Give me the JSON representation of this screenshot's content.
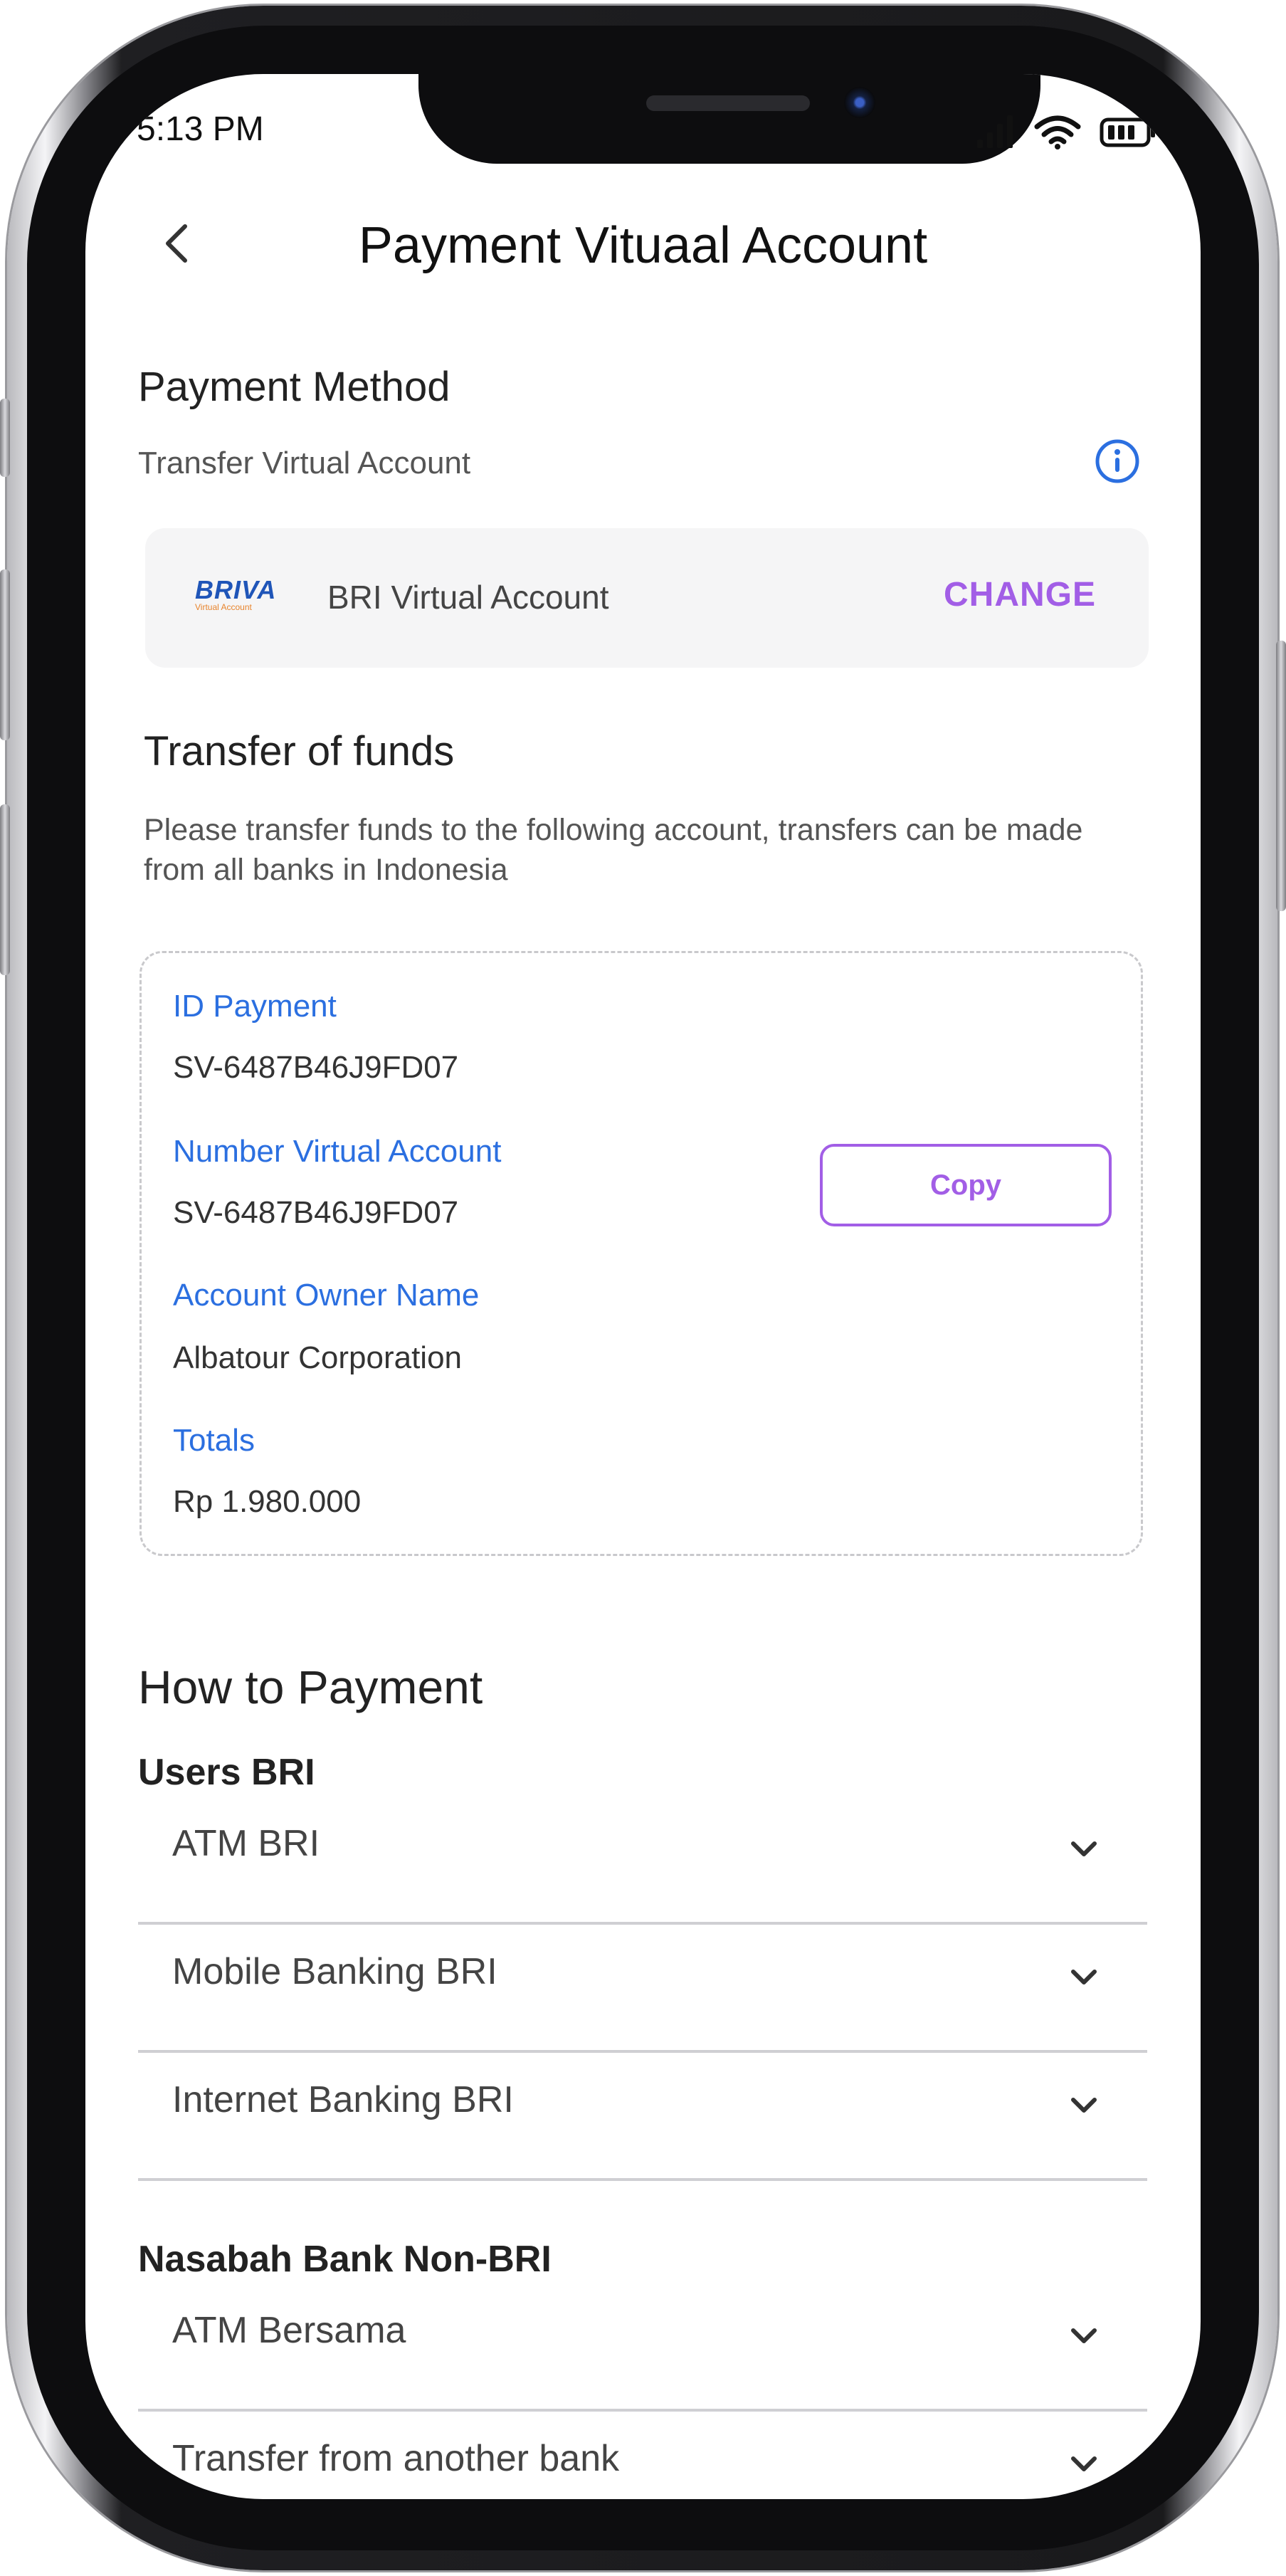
{
  "status_bar": {
    "time": "5:13 PM"
  },
  "header": {
    "title": "Payment Vituaal Account"
  },
  "payment_method": {
    "heading": "Payment Method",
    "subtitle": "Transfer Virtual Account",
    "logo_text": "BRIVA",
    "logo_subtext": "Virtual Account",
    "bank_name": "BRI Virtual Account",
    "change_label": "CHANGE"
  },
  "transfer": {
    "heading": "Transfer of funds",
    "description": "Please transfer funds to the following account, transfers can be made from all banks in Indonesia",
    "id_payment_label": "ID Payment",
    "id_payment_value": "SV-6487B46J9FD07",
    "va_label": "Number Virtual Account",
    "va_value": "SV-6487B46J9FD07",
    "owner_label": "Account Owner Name",
    "owner_value": "Albatour Corporation",
    "totals_label": "Totals",
    "totals_value": "Rp 1.980.000",
    "copy_label": "Copy"
  },
  "how_to": {
    "heading": "How to Payment",
    "group_bri": {
      "title": "Users BRI",
      "items": [
        "ATM BRI",
        "Mobile Banking BRI",
        "Internet Banking BRI"
      ]
    },
    "group_non_bri": {
      "title": "Nasabah Bank Non-BRI",
      "items": [
        "ATM Bersama",
        "Transfer from another bank"
      ]
    }
  },
  "colors": {
    "accent": "#a25ee6",
    "label_blue": "#2b6fe0"
  }
}
